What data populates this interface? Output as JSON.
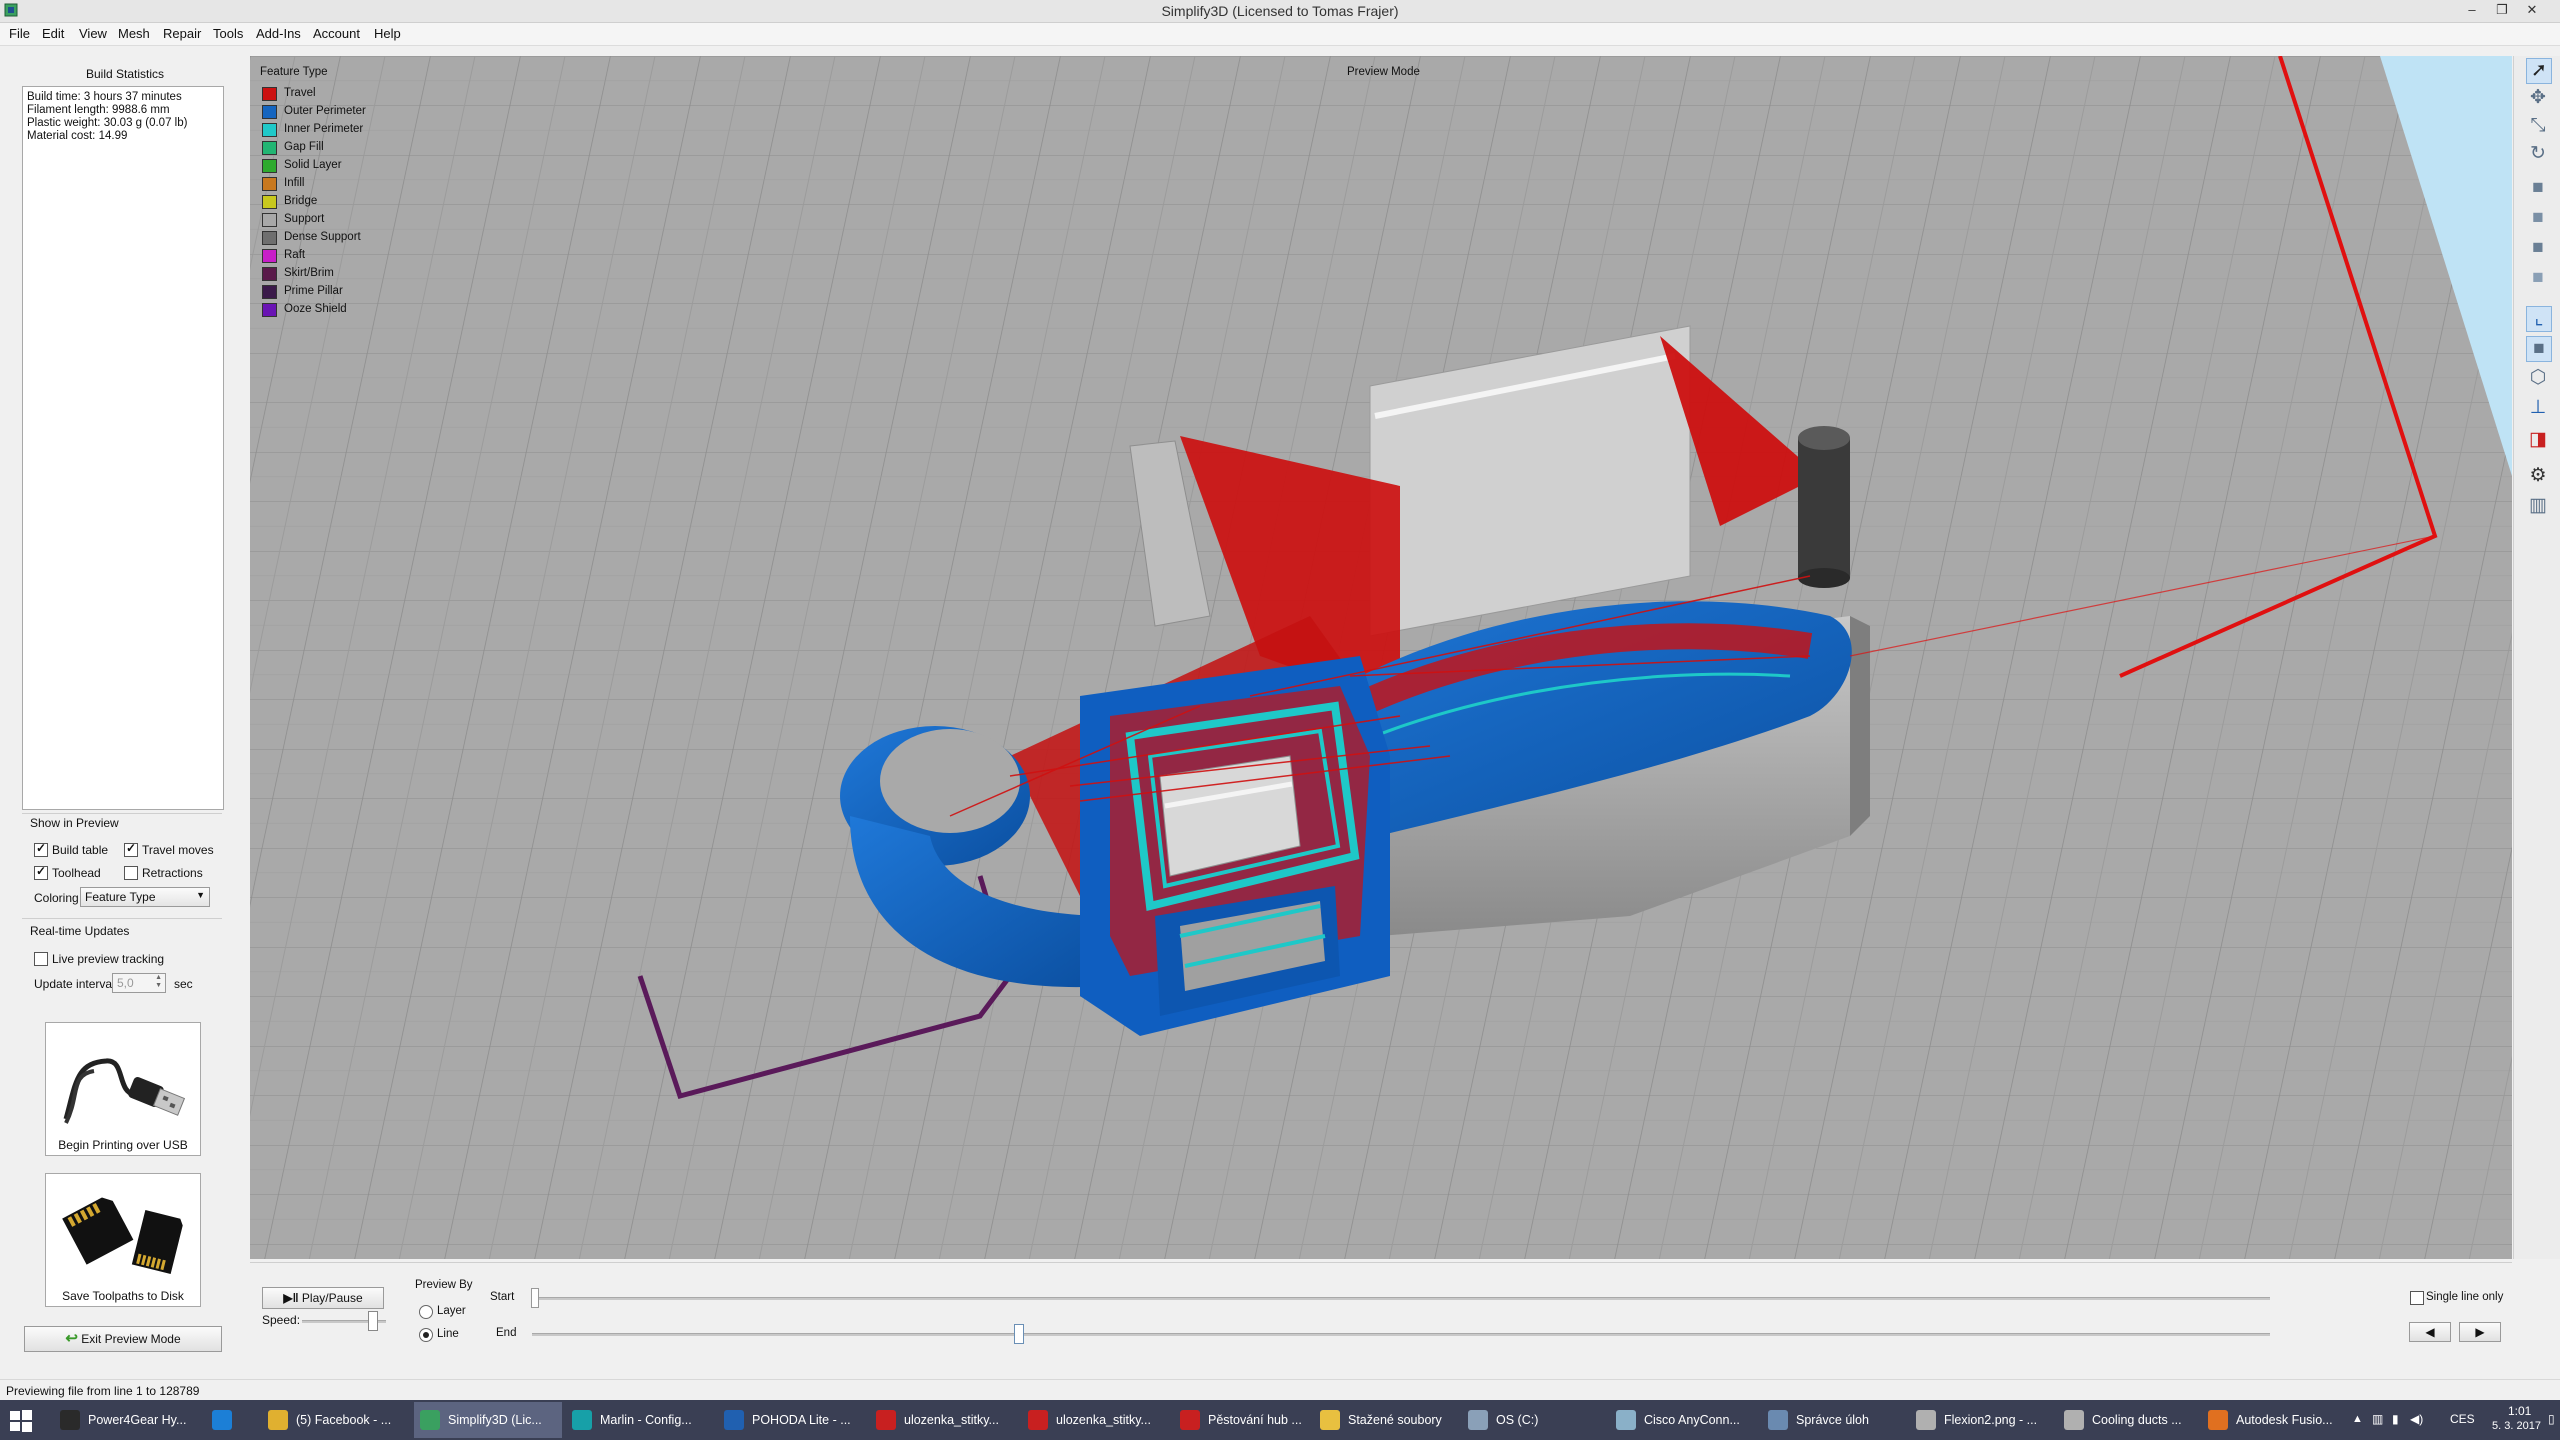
{
  "window": {
    "title": "Simplify3D (Licensed to Tomas Frajer)"
  },
  "menu": [
    "File",
    "Edit",
    "View",
    "Mesh",
    "Repair",
    "Tools",
    "Add-Ins",
    "Account",
    "Help"
  ],
  "left_panel": {
    "build_statistics_title": "Build Statistics",
    "stats": [
      "Build time: 3 hours 37 minutes",
      "Filament length: 9988.6 mm",
      "Plastic weight: 30.03 g (0.07 lb)",
      "Material cost: 14.99"
    ],
    "show_in_preview_title": "Show in Preview",
    "build_table": "Build table",
    "travel_moves": "Travel moves",
    "toolhead": "Toolhead",
    "retractions": "Retractions",
    "coloring_label": "Coloring",
    "coloring_value": "Feature Type",
    "realtime_title": "Real-time Updates",
    "live_preview": "Live preview tracking",
    "update_interval_label": "Update interval",
    "update_interval_value": "5,0",
    "update_interval_unit": "sec",
    "begin_printing": "Begin Printing over USB",
    "save_toolpaths": "Save Toolpaths to Disk",
    "exit_preview": "Exit Preview Mode"
  },
  "viewport": {
    "mode_label": "Preview Mode",
    "legend_title": "Feature Type",
    "legend": [
      {
        "label": "Travel",
        "color": "#cc1111"
      },
      {
        "label": "Outer Perimeter",
        "color": "#1565c0"
      },
      {
        "label": "Inner Perimeter",
        "color": "#1ec8c8"
      },
      {
        "label": "Gap Fill",
        "color": "#22b573"
      },
      {
        "label": "Solid Layer",
        "color": "#2eaa2e"
      },
      {
        "label": "Infill",
        "color": "#c8781e"
      },
      {
        "label": "Bridge",
        "color": "#c8c81e"
      },
      {
        "label": "Support",
        "color": "#a8a8a8"
      },
      {
        "label": "Dense Support",
        "color": "#6e6e6e"
      },
      {
        "label": "Raft",
        "color": "#c81ec8"
      },
      {
        "label": "Skirt/Brim",
        "color": "#5a1a4a"
      },
      {
        "label": "Prime Pillar",
        "color": "#3b1a4a"
      },
      {
        "label": "Ooze Shield",
        "color": "#6a14b4"
      }
    ]
  },
  "right_toolbar": [
    "select-icon",
    "move-icon",
    "scale-icon",
    "rotate-icon",
    "front-view-icon",
    "back-view-icon",
    "left-view-icon",
    "right-view-icon",
    "axes-icon",
    "solid-view-icon",
    "wireframe-icon",
    "normals-icon",
    "cross-section-icon",
    "settings-gear-icon",
    "layers-icon"
  ],
  "bottom": {
    "play_pause": "Play/Pause",
    "speed_label": "Speed:",
    "preview_by_label": "Preview By",
    "layer": "Layer",
    "line": "Line",
    "start_label": "Start",
    "end_label": "End",
    "single_line_only": "Single line only",
    "end_position": 0.28
  },
  "status": "Previewing file from line 1 to 128789",
  "taskbar": {
    "items": [
      {
        "label": "Power4Gear Hy...",
        "color": "#2a2a2a"
      },
      {
        "label": "",
        "color": "#1c7fd6"
      },
      {
        "label": "(5) Facebook - ...",
        "color": "#e0b030"
      },
      {
        "label": "Simplify3D (Lic...",
        "color": "#3aa060"
      },
      {
        "label": "Marlin - Config...",
        "color": "#17a0a8"
      },
      {
        "label": "POHODA Lite - ...",
        "color": "#2060b0"
      },
      {
        "label": "ulozenka_stitky...",
        "color": "#c82020"
      },
      {
        "label": "ulozenka_stitky...",
        "color": "#c82020"
      },
      {
        "label": "Pěstování hub ...",
        "color": "#c82020"
      },
      {
        "label": "Stažené soubory",
        "color": "#e8c040"
      },
      {
        "label": "OS (C:)",
        "color": "#8aa0b8"
      },
      {
        "label": "Cisco AnyConn...",
        "color": "#8ab0c8"
      },
      {
        "label": "Správce úloh",
        "color": "#6a8ab0"
      },
      {
        "label": "Flexion2.png - ...",
        "color": "#b0b0b0"
      },
      {
        "label": "Cooling ducts ...",
        "color": "#b0b0b0"
      },
      {
        "label": "Autodesk Fusio...",
        "color": "#e07020"
      }
    ],
    "language": "CES",
    "time": "1:01",
    "date": "5. 3. 2017"
  }
}
